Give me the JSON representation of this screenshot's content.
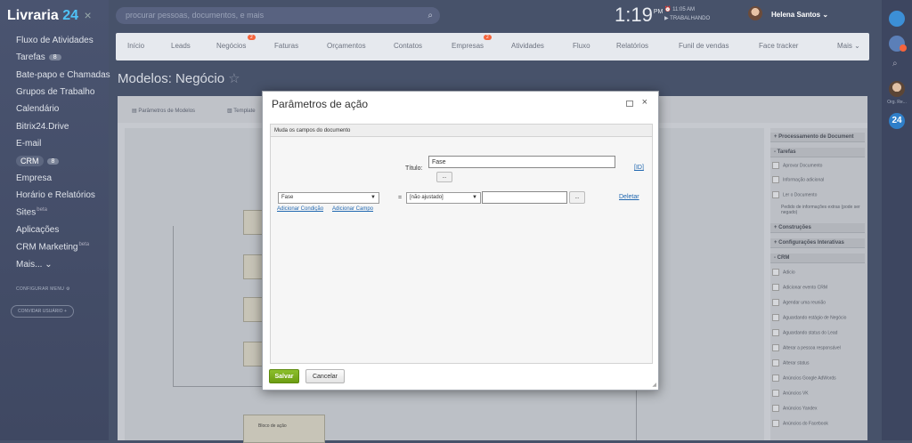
{
  "app": {
    "logo_text": "Livraria",
    "logo_num": "24",
    "logo_close": "×"
  },
  "sidebar": {
    "items": [
      {
        "label": "Fluxo de Atividades"
      },
      {
        "label": "Tarefas",
        "badge": "8"
      },
      {
        "label": "Bate-papo e Chamadas"
      },
      {
        "label": "Grupos de Trabalho"
      },
      {
        "label": "Calendário"
      },
      {
        "label": "Bitrix24.Drive"
      },
      {
        "label": "E-mail"
      },
      {
        "label": "CRM",
        "badge": "8"
      },
      {
        "label": "Empresa"
      },
      {
        "label": "Horário e Relatórios"
      },
      {
        "label": "Sites",
        "sup": "beta"
      },
      {
        "label": "Aplicações"
      },
      {
        "label": "CRM Marketing",
        "sup": "beta"
      },
      {
        "label": "Mais...",
        "chevron": "⌄"
      }
    ],
    "configure_menu": "CONFIGURAR MENU",
    "invite_users": "CONVIDAR USUÁRIO"
  },
  "header": {
    "search_placeholder": "procurar pessoas, documentos, e mais",
    "search_icon": "search-icon",
    "time": "1:19",
    "ampm": "PM",
    "alarm": "⏰ 11:05 AM",
    "status": "▶ TRABALHANDO",
    "user_name": "Helena Santos",
    "user_chevron": "⌄"
  },
  "nav": {
    "items": [
      {
        "label": "Início"
      },
      {
        "label": "Leads"
      },
      {
        "label": "Negócios",
        "badge": "2"
      },
      {
        "label": "Faturas"
      },
      {
        "label": "Orçamentos"
      },
      {
        "label": "Contatos"
      },
      {
        "label": "Empresas",
        "badge": "2"
      },
      {
        "label": "Atividades"
      },
      {
        "label": "Fluxo"
      },
      {
        "label": "Relatórios"
      },
      {
        "label": "Funil de vendas"
      },
      {
        "label": "Face tracker"
      },
      {
        "label": "Mais ⌄"
      }
    ]
  },
  "page": {
    "title": "Modelos: Negócio",
    "star": "☆",
    "toolbar": [
      "Parâmetros de Modelos",
      "Template"
    ],
    "canvas_block_label": "Bloco de ação"
  },
  "right_panel": {
    "sections": [
      {
        "label": "+ Processamento de Document"
      },
      {
        "label": "- Tarefas"
      },
      {
        "label": "Aprovar Documento"
      },
      {
        "label": "Informação adicional"
      },
      {
        "label": "Ler o Documento"
      },
      {
        "label": "Pedido de informações extras (pode ser negado)"
      },
      {
        "label": "+ Construções"
      },
      {
        "label": "+ Configurações Interativas"
      },
      {
        "label": "- CRM"
      },
      {
        "label": "Adicio"
      },
      {
        "label": "Adicionar evento CRM"
      },
      {
        "label": "Agendar uma reunião"
      },
      {
        "label": "Aguardando estágio de Negócio"
      },
      {
        "label": "Aguardando status do Lead"
      },
      {
        "label": "Alterar a pessoa responsável"
      },
      {
        "label": "Alterar status"
      },
      {
        "label": "Anúncios Google AdWords"
      },
      {
        "label": "Anúncios VK"
      },
      {
        "label": "Anúncios Yandex"
      },
      {
        "label": "Anúncios do Facebook"
      }
    ]
  },
  "rail": {
    "user_label": "Org. Re...",
    "b24": "24"
  },
  "dialog": {
    "title": "Parâmetros de ação",
    "subtitle": "Muda os campos do documento",
    "title_label": "Título:",
    "title_value": "Fase",
    "dots": "...",
    "id_link": "[ID]",
    "field_select": "Fase",
    "equals": "=",
    "value_select": "[não ajustado]",
    "delete_link": "Deletar",
    "add_condition": "Adicionar Condição",
    "add_field": "Adicionar Campo",
    "save": "Salvar",
    "cancel": "Cancelar",
    "maximize_icon": "maximize-icon",
    "close": "×"
  }
}
